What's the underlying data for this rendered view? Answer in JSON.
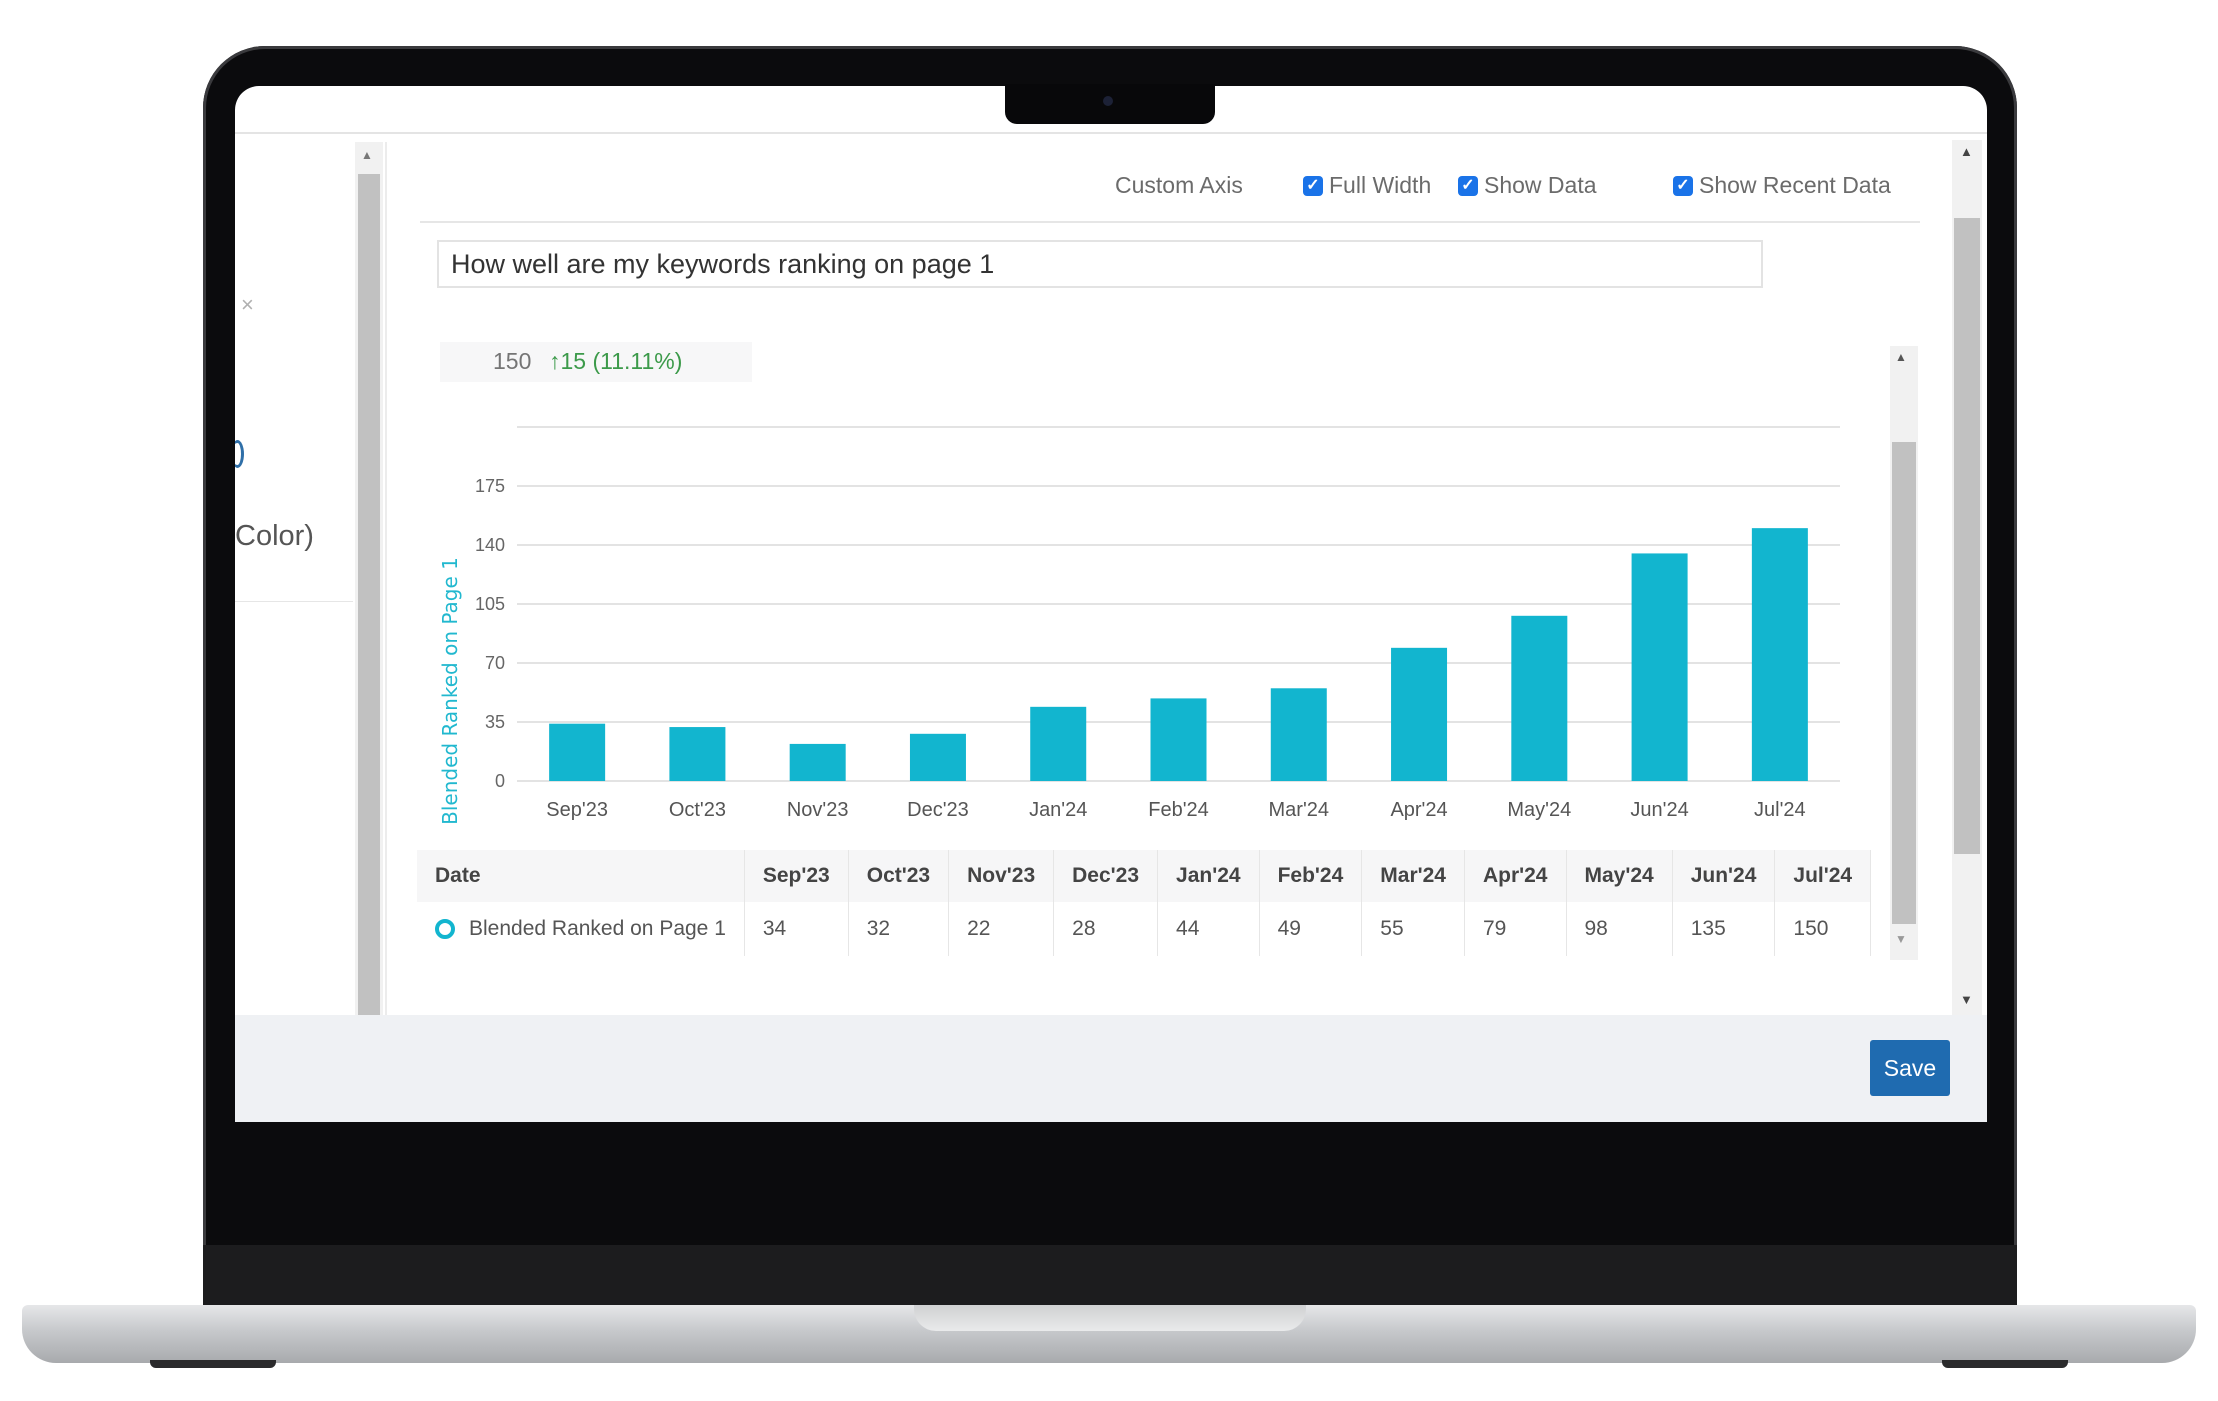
{
  "left_panel": {
    "close_glyph": "×",
    "partial_label": "Color)"
  },
  "toolbar": {
    "custom_axis_label": "Custom Axis",
    "full_width": {
      "label": "Full Width",
      "checked": true
    },
    "show_data": {
      "label": "Show Data",
      "checked": true
    },
    "show_recent_data": {
      "label": "Show Recent Data",
      "checked": true
    },
    "check_glyph": "✓"
  },
  "title_input": {
    "value": "How well are my keywords ranking on page 1"
  },
  "stat": {
    "value": "150",
    "change": "↑15 (11.11%)",
    "change_color": "#3c9a4a"
  },
  "chart_data": {
    "type": "bar",
    "title": "",
    "xlabel": "",
    "ylabel": "Blended Ranked on Page 1",
    "categories": [
      "Sep'23",
      "Oct'23",
      "Nov'23",
      "Dec'23",
      "Jan'24",
      "Feb'24",
      "Mar'24",
      "Apr'24",
      "May'24",
      "Jun'24",
      "Jul'24"
    ],
    "series": [
      {
        "name": "Blended Ranked on Page 1",
        "values": [
          34,
          32,
          22,
          28,
          44,
          49,
          55,
          79,
          98,
          135,
          150
        ],
        "color": "#12b5cf"
      }
    ],
    "yticks": [
      0,
      35,
      70,
      105,
      140,
      175
    ],
    "ylim": [
      0,
      210
    ],
    "grid": true,
    "legend": "none"
  },
  "table": {
    "header_label": "Date",
    "columns": [
      "Sep'23",
      "Oct'23",
      "Nov'23",
      "Dec'23",
      "Jan'24",
      "Feb'24",
      "Mar'24",
      "Apr'24",
      "May'24",
      "Jun'24",
      "Jul'24"
    ],
    "rows": [
      {
        "label": "Blended Ranked on Page 1",
        "values": [
          "34",
          "32",
          "22",
          "28",
          "44",
          "49",
          "55",
          "79",
          "98",
          "135",
          "150"
        ]
      }
    ]
  },
  "scroll_glyphs": {
    "up": "▲",
    "down": "▼"
  },
  "footer": {
    "save_label": "Save"
  }
}
